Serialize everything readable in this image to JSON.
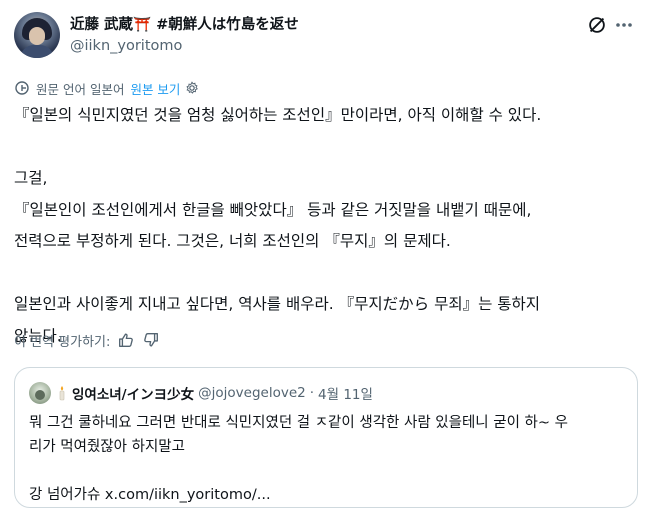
{
  "author": {
    "display_name": "近藤 武蔵⛩️ #朝鮮人は竹島を返せ",
    "handle": "@iikn_yoritomo"
  },
  "icons": {
    "grok": "grok-slash-icon",
    "more": "more-dots-icon",
    "translate": "translate-globe-icon",
    "settings": "gear-icon",
    "thumbs_up": "thumbs-up-icon",
    "thumbs_down": "thumbs-down-icon",
    "candle": "candle-emoji-icon"
  },
  "translation": {
    "source_label": "원문 언어 일본어",
    "show_original": "원본 보기"
  },
  "tweet_lines": {
    "l1": "『일본의 식민지였던 것을 엄청 싫어하는 조선인』만이라면, 아직 이해할 수 있다.",
    "l2": "그걸,",
    "l3": "『일본인이 조선인에게서 한글을 빼앗았다』 등과 같은 거짓말을 내뱉기 때문에,",
    "l4": "전력으로 부정하게 된다. 그것은, 너희 조선인의 『무지』의 문제다.",
    "l5": "일본인과 사이좋게 지내고 싶다면, 역사를 배우라. 『무지だから 무죄』는 통하지",
    "l6": "않는다."
  },
  "rate_translation": "이 번역 평가하기:",
  "quoted": {
    "display_name": "잉여소녀/インヨ少女",
    "handle": "@jojovegelove2",
    "separator": "·",
    "date": "4월 11일",
    "l1": "뭐 그건 쿨하네요 그러면 반대로 식민지였던 걸 ㅈ같이 생각한 사람 있을테니 굳이 하~ 우",
    "l2": "리가 먹여줬잖아 하지말고",
    "l3": "강 넘어가슈 x.com/iikn_yoritomo/..."
  },
  "colors": {
    "text": "#0f1419",
    "secondary": "#536471",
    "link": "#1d9bf0",
    "border": "#cfd9de"
  }
}
